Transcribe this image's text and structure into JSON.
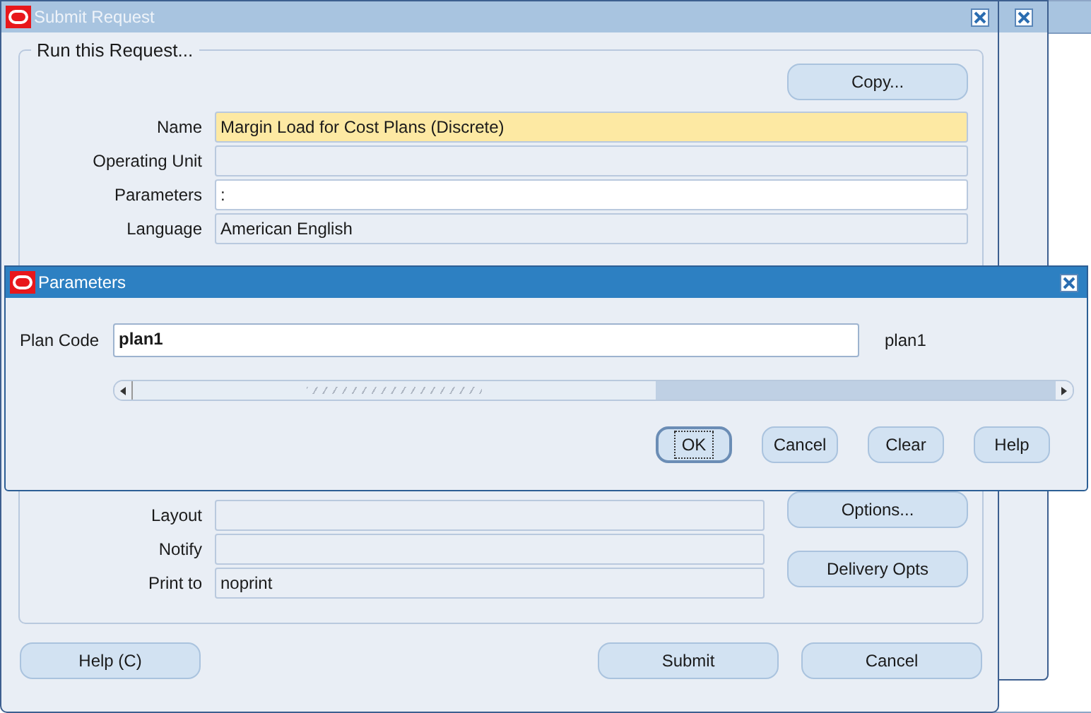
{
  "window": {
    "title": "Submit Request"
  },
  "group": {
    "title": "Run this Request..."
  },
  "copy_button": {
    "label": "Copy..."
  },
  "fields": [
    {
      "label": "Name",
      "value": "Margin Load for Cost Plans (Discrete)",
      "kind": "required"
    },
    {
      "label": "Operating Unit",
      "kind": "readonly"
    },
    {
      "label": "Parameters",
      "value": ":",
      "kind": "editable"
    },
    {
      "label": "Language",
      "value": "American English",
      "kind": "readonly"
    }
  ],
  "output_fields": [
    {
      "label": "Layout"
    },
    {
      "label": "Notify"
    },
    {
      "label": "Print to",
      "value": "noprint"
    }
  ],
  "side_buttons": [
    {
      "label": "Options..."
    },
    {
      "label": "Delivery Opts"
    }
  ],
  "footer_buttons": [
    {
      "label": "Help (C)"
    },
    {
      "label": "Submit"
    },
    {
      "label": "Cancel"
    }
  ],
  "dialog": {
    "title": "Parameters",
    "parameters": [
      {
        "label": "Plan Code",
        "value": "plan1",
        "description": "plan1"
      }
    ],
    "buttons": [
      {
        "label": "OK",
        "focused": true
      },
      {
        "label": "Cancel",
        "focused": false
      },
      {
        "label": "Clear",
        "focused": false
      },
      {
        "label": "Help",
        "focused": false
      }
    ]
  }
}
